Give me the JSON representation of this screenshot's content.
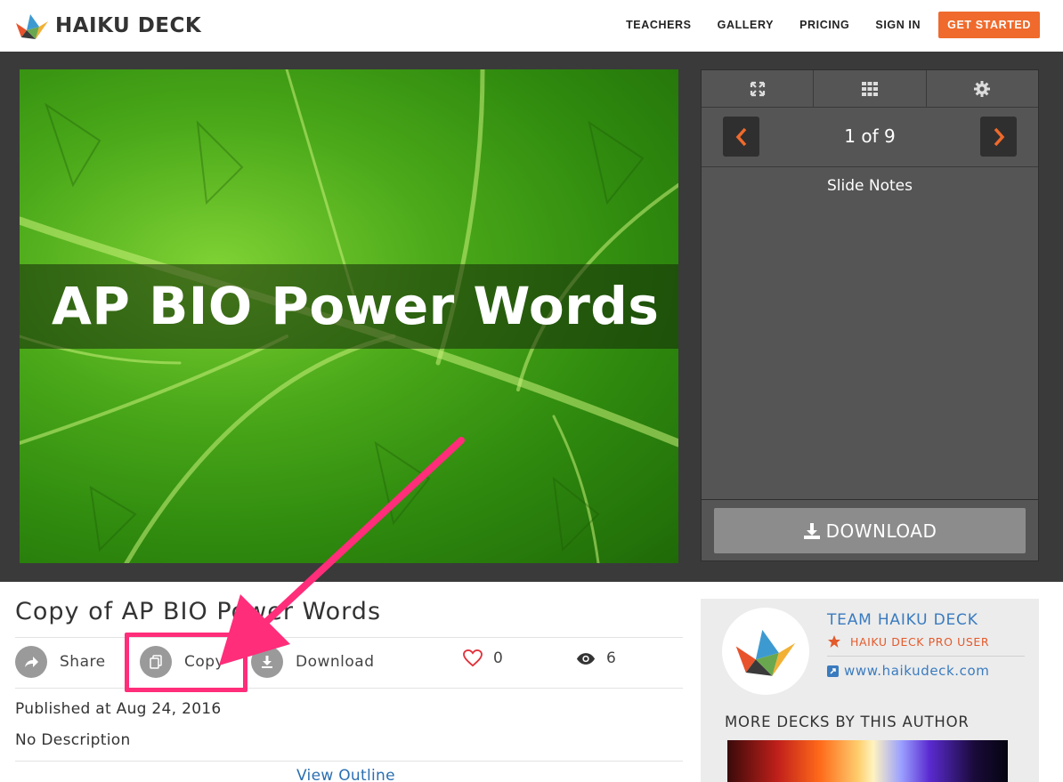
{
  "header": {
    "brand": "HAIKU DECK",
    "nav": [
      {
        "label": "TEACHERS"
      },
      {
        "label": "GALLERY"
      },
      {
        "label": "PRICING"
      },
      {
        "label": "SIGN IN"
      }
    ],
    "cta_label": "GET STARTED"
  },
  "slide": {
    "title": "AP BIO Power Words"
  },
  "panel": {
    "page_indicator": "1 of 9",
    "notes_label": "Slide Notes",
    "download_label": "DOWNLOAD"
  },
  "deck": {
    "title": "Copy of AP BIO Power Words",
    "actions": {
      "share_label": "Share",
      "copy_label": "Copy",
      "download_label": "Download"
    },
    "likes": "0",
    "views": "6",
    "published": "Published at Aug 24, 2016",
    "description": "No Description",
    "outline_link": "View Outline"
  },
  "author": {
    "name": "TEAM HAIKU DECK",
    "badge": "HAIKU DECK PRO USER",
    "website": "www.haikudeck.com",
    "more_label": "MORE DECKS BY THIS AUTHOR"
  },
  "colors": {
    "accent": "#ef6a2c",
    "link": "#3a7bbf",
    "annotation": "#ff2d7a",
    "stage_bg": "#3a3a3a"
  }
}
